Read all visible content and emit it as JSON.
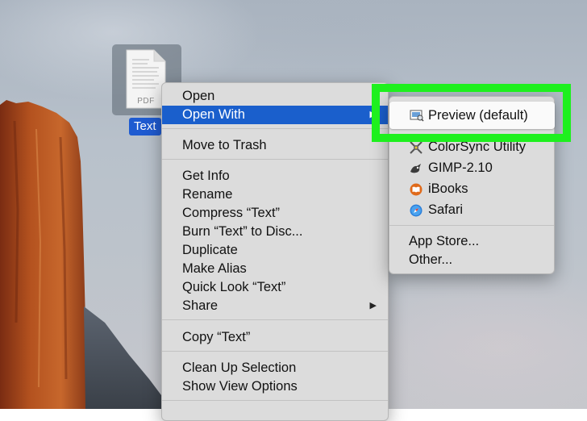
{
  "file": {
    "name": "Text",
    "type_label": "PDF"
  },
  "context_menu": {
    "items": [
      {
        "label": "Open"
      },
      {
        "label": "Open With"
      },
      {
        "label": "Move to Trash"
      },
      {
        "label": "Get Info"
      },
      {
        "label": "Rename"
      },
      {
        "label": "Compress “Text”"
      },
      {
        "label": "Burn “Text” to Disc..."
      },
      {
        "label": "Duplicate"
      },
      {
        "label": "Make Alias"
      },
      {
        "label": "Quick Look “Text”"
      },
      {
        "label": "Share"
      },
      {
        "label": "Copy “Text”"
      },
      {
        "label": "Clean Up Selection"
      },
      {
        "label": "Show View Options"
      }
    ]
  },
  "open_with_submenu": {
    "default_app": {
      "label": "Preview (default)",
      "icon": "preview-icon"
    },
    "apps": [
      {
        "label": "ColorSync Utility",
        "icon": "colorsync-icon"
      },
      {
        "label": "GIMP-2.10",
        "icon": "gimp-icon"
      },
      {
        "label": "iBooks",
        "icon": "ibooks-icon"
      },
      {
        "label": "Safari",
        "icon": "safari-icon"
      }
    ],
    "other_items": [
      {
        "label": "App Store..."
      },
      {
        "label": "Other..."
      }
    ]
  },
  "colors": {
    "selection": "#1a5fcc",
    "callout": "#1ef01e"
  }
}
